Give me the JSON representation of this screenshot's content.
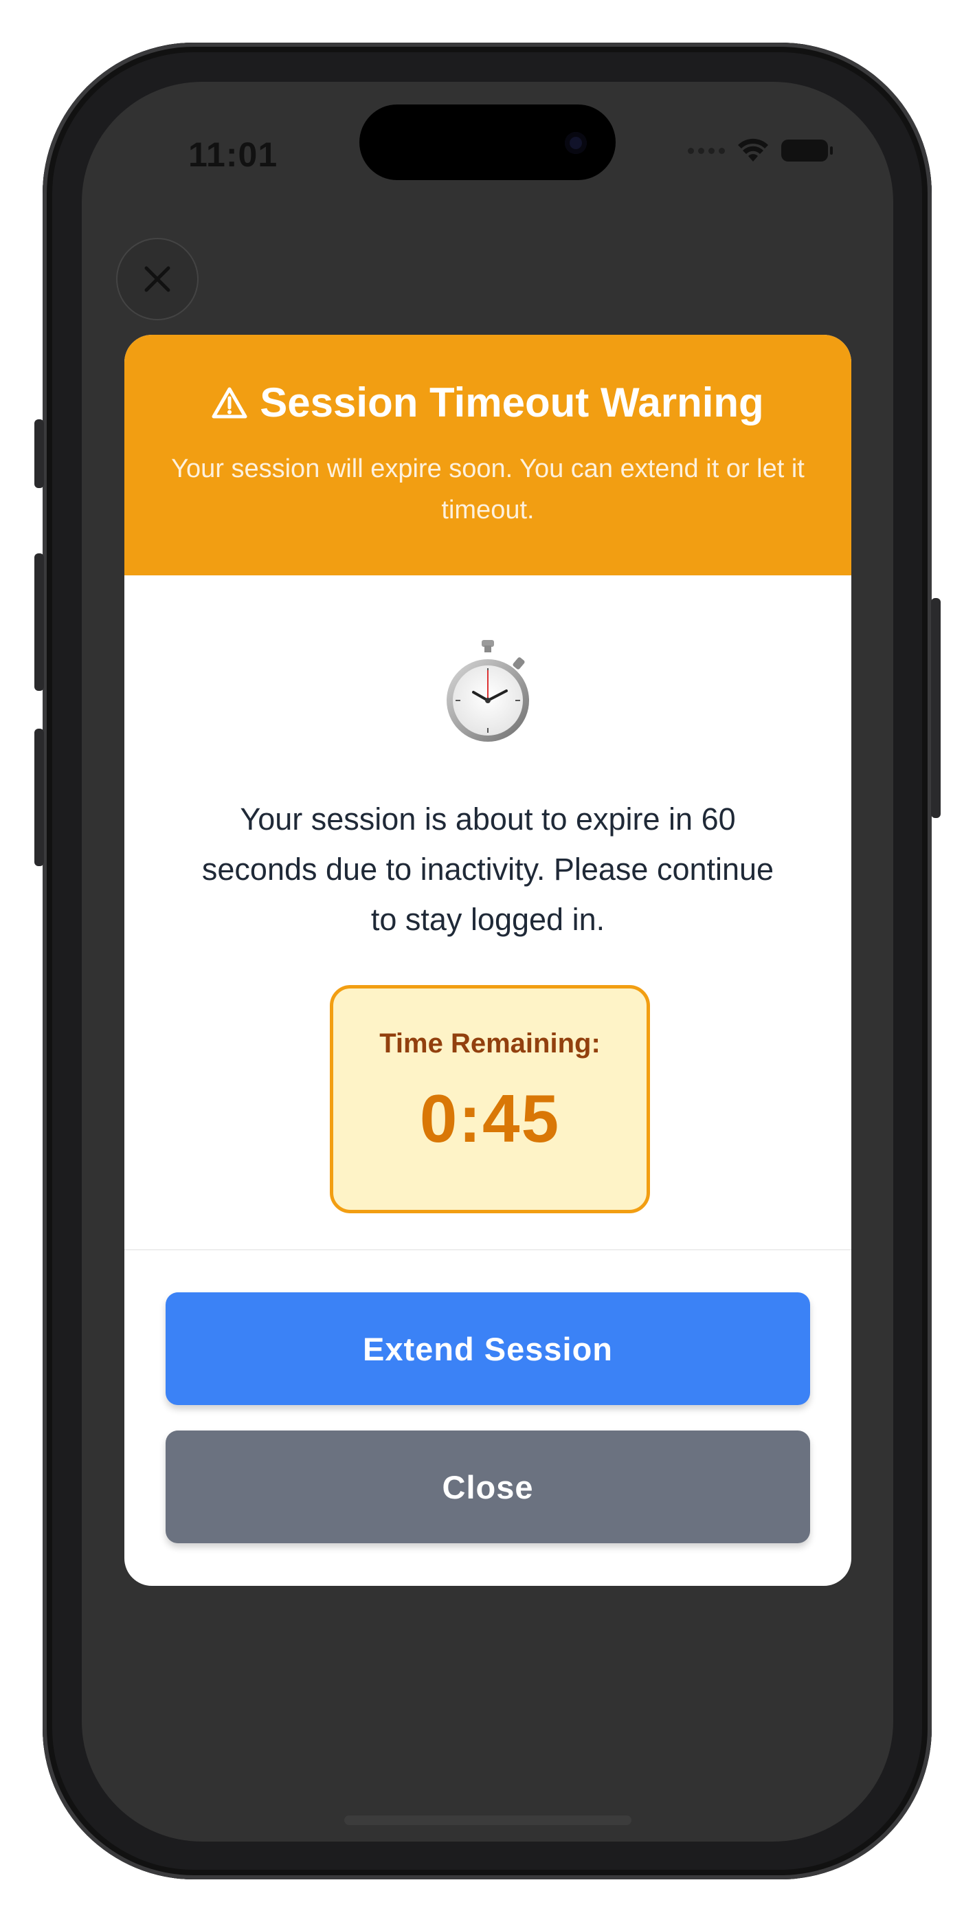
{
  "status_bar": {
    "time": "11:01"
  },
  "overlay": {
    "close_icon": "close-icon"
  },
  "modal": {
    "header": {
      "icon": "warning-triangle-icon",
      "title": "Session Timeout Warning",
      "subtitle": "Your session will expire soon. You can extend it or let it timeout.",
      "color": "#f29e12"
    },
    "illustration_icon": "stopwatch-icon",
    "message": "Your session is about to expire in 60 seconds due to inactivity. Please continue to stay logged in.",
    "timer": {
      "label": "Time Remaining:",
      "value": "0:45"
    },
    "buttons": {
      "extend_label": "Extend Session",
      "extend_color": "#3b82f6",
      "close_label": "Close",
      "close_color": "#6b7280"
    }
  }
}
